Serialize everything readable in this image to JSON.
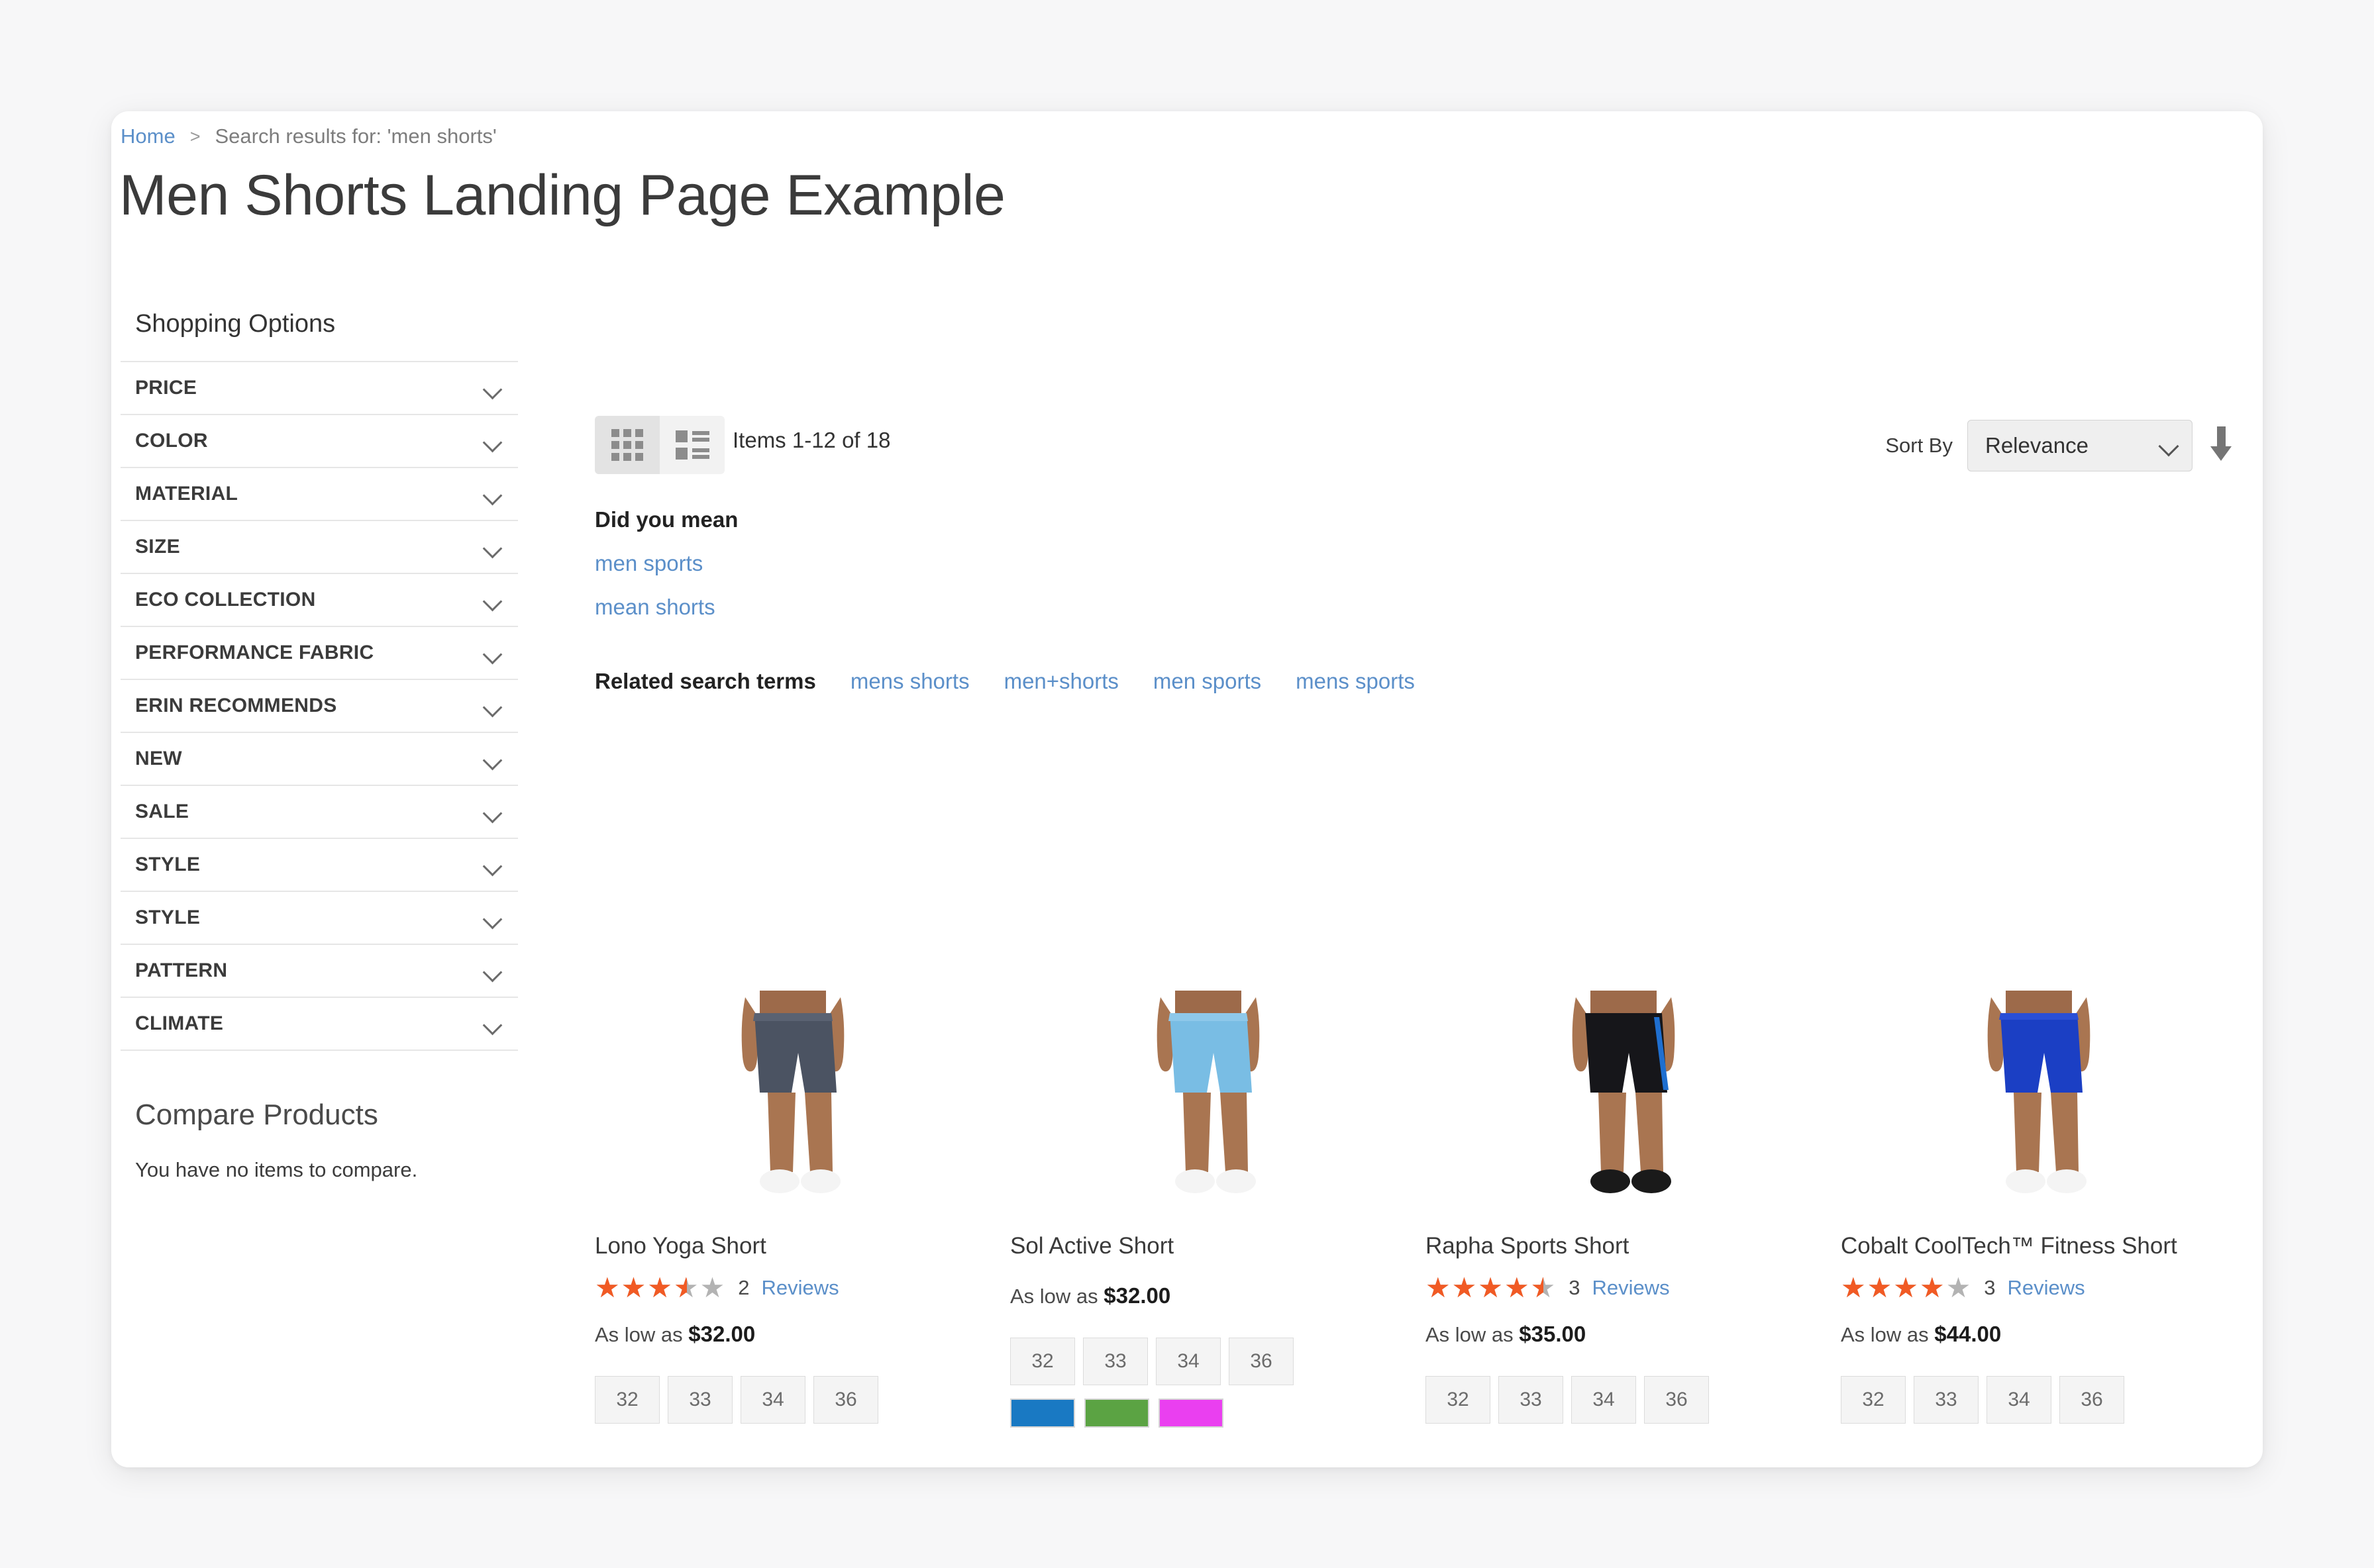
{
  "breadcrumb": {
    "home": "Home",
    "separator": ">",
    "current": "Search results for: 'men shorts'"
  },
  "page_title": "Men Shorts Landing Page Example",
  "sidebar": {
    "title": "Shopping Options",
    "filters": [
      {
        "label": "PRICE"
      },
      {
        "label": "COLOR"
      },
      {
        "label": "MATERIAL"
      },
      {
        "label": "SIZE"
      },
      {
        "label": "ECO COLLECTION"
      },
      {
        "label": "PERFORMANCE FABRIC"
      },
      {
        "label": "ERIN RECOMMENDS"
      },
      {
        "label": "NEW"
      },
      {
        "label": "SALE"
      },
      {
        "label": "STYLE"
      },
      {
        "label": "STYLE"
      },
      {
        "label": "PATTERN"
      },
      {
        "label": "CLIMATE"
      }
    ],
    "compare": {
      "title": "Compare Products",
      "empty_text": "You have no items to compare."
    }
  },
  "toolbar": {
    "grid_view_icon": "grid-view-icon",
    "list_view_icon": "list-view-icon",
    "active_view": "grid",
    "items_count": "Items 1-12 of 18",
    "sort_label": "Sort By",
    "sort_value": "Relevance",
    "sort_direction_icon": "arrow-down-icon"
  },
  "did_you_mean": {
    "title": "Did you mean",
    "suggestions": [
      "men sports",
      "mean shorts"
    ]
  },
  "related_search": {
    "title": "Related search terms",
    "terms": [
      "mens shorts",
      "men+shorts",
      "men sports",
      "mens sports"
    ]
  },
  "products": [
    {
      "name": "Lono Yoga Short",
      "rating": 3.5,
      "rating_percent": "70%",
      "review_count": "2",
      "review_word": "Reviews",
      "price_prefix": "As low as",
      "price": "$32.00",
      "sizes": [
        "32",
        "33",
        "34",
        "36"
      ],
      "colors": [],
      "short_color": "#4b5362"
    },
    {
      "name": "Sol Active Short",
      "rating": 0,
      "rating_percent": "0%",
      "review_count": "",
      "review_word": "",
      "price_prefix": "As low as",
      "price": "$32.00",
      "sizes": [
        "32",
        "33",
        "34",
        "36"
      ],
      "colors": [
        "#1979c3",
        "#5ba343",
        "#ea3ff0"
      ],
      "short_color": "#79bde4"
    },
    {
      "name": "Rapha Sports Short",
      "rating": 4.5,
      "rating_percent": "90%",
      "review_count": "3",
      "review_word": "Reviews",
      "price_prefix": "As low as",
      "price": "$35.00",
      "sizes": [
        "32",
        "33",
        "34",
        "36"
      ],
      "colors": [],
      "short_color": "#16161a"
    },
    {
      "name": "Cobalt CoolTech™ Fitness Short",
      "rating": 4.0,
      "rating_percent": "80%",
      "review_count": "3",
      "review_word": "Reviews",
      "price_prefix": "As low as",
      "price": "$44.00",
      "sizes": [
        "32",
        "33",
        "34",
        "36"
      ],
      "colors": [],
      "short_color": "#1b3fc4"
    }
  ],
  "colors": {
    "link": "#5b8fc9",
    "star_filled": "#f15a24",
    "star_empty": "#b3b3b3",
    "text": "#3b3b3b"
  }
}
